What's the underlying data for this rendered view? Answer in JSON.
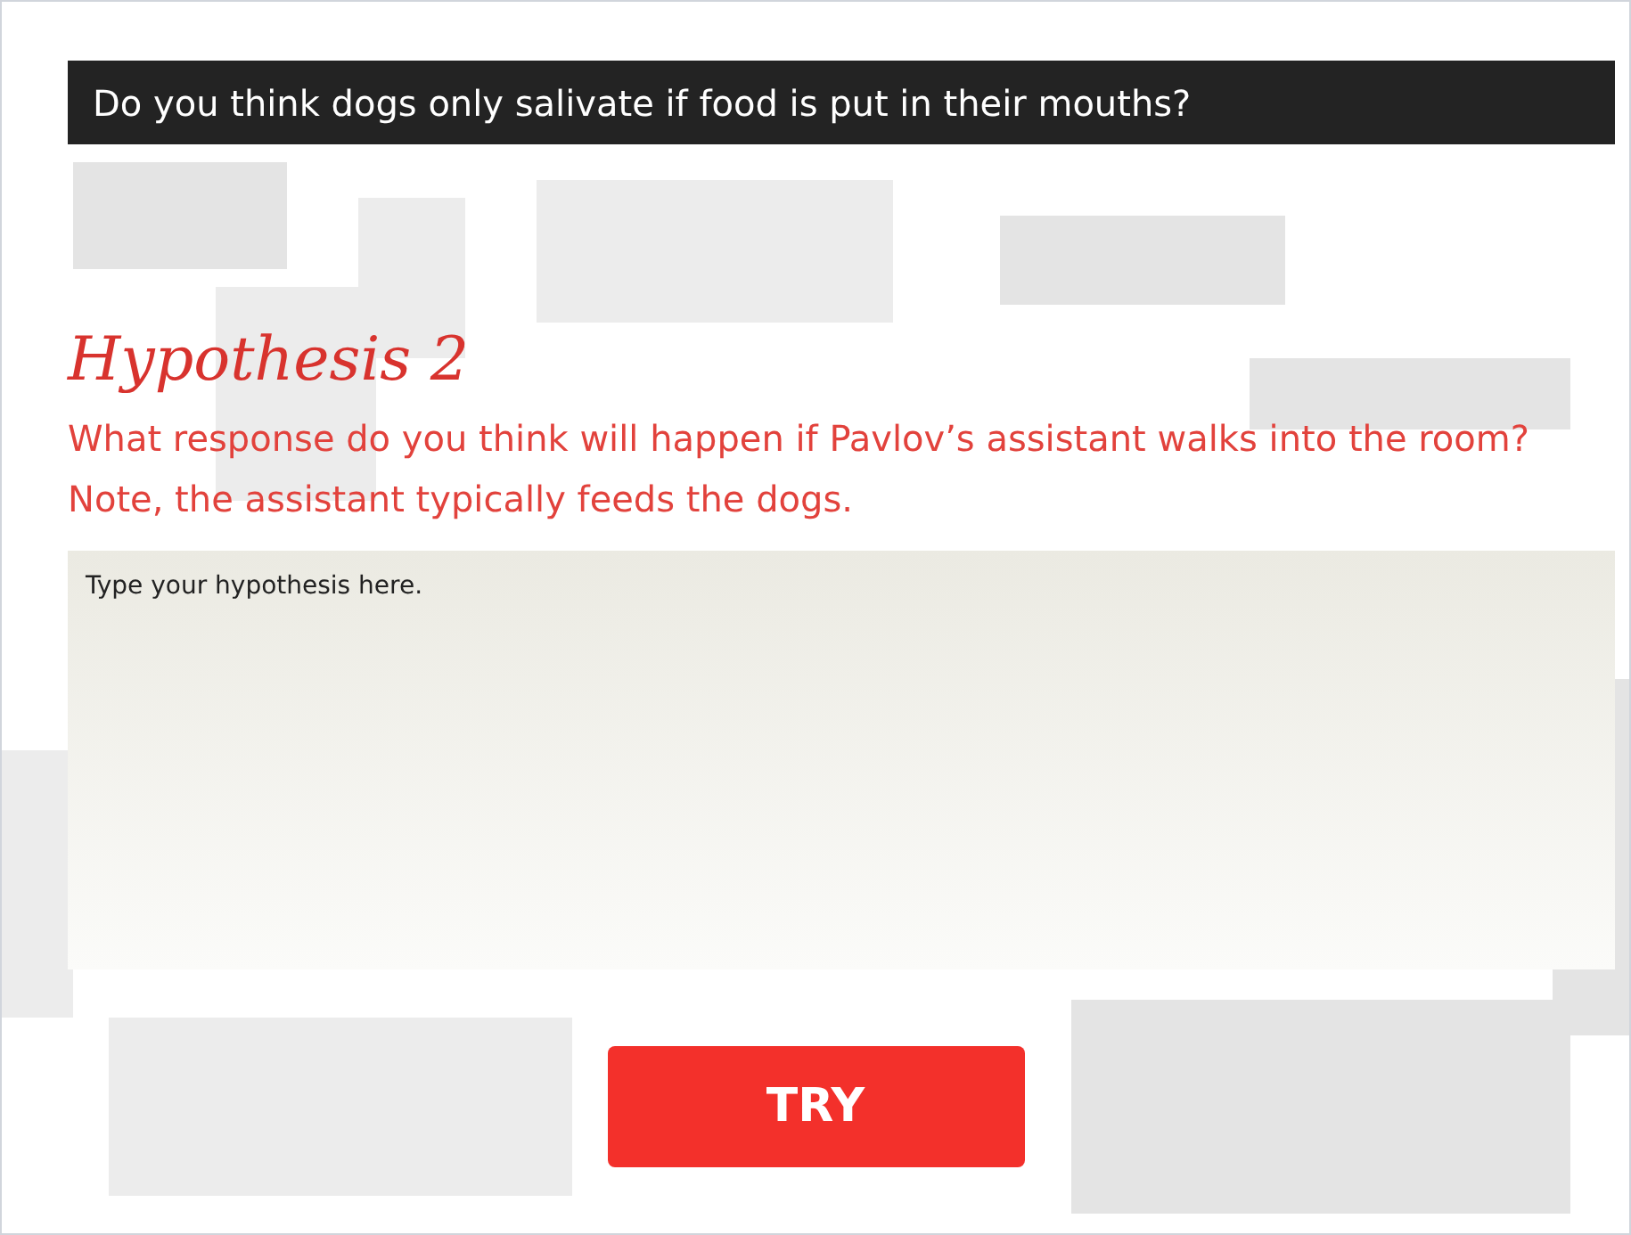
{
  "question_bar": {
    "text": "Do you think dogs only salivate if food is put in their mouths?"
  },
  "heading": "Hypothesis 2",
  "prompt": "What response do you think will happen if Pavlov’s assistant walks into the room? Note, the assistant typically feeds the dogs.",
  "answer": {
    "placeholder": "Type your hypothesis here."
  },
  "buttons": [
    "TRY"
  ]
}
